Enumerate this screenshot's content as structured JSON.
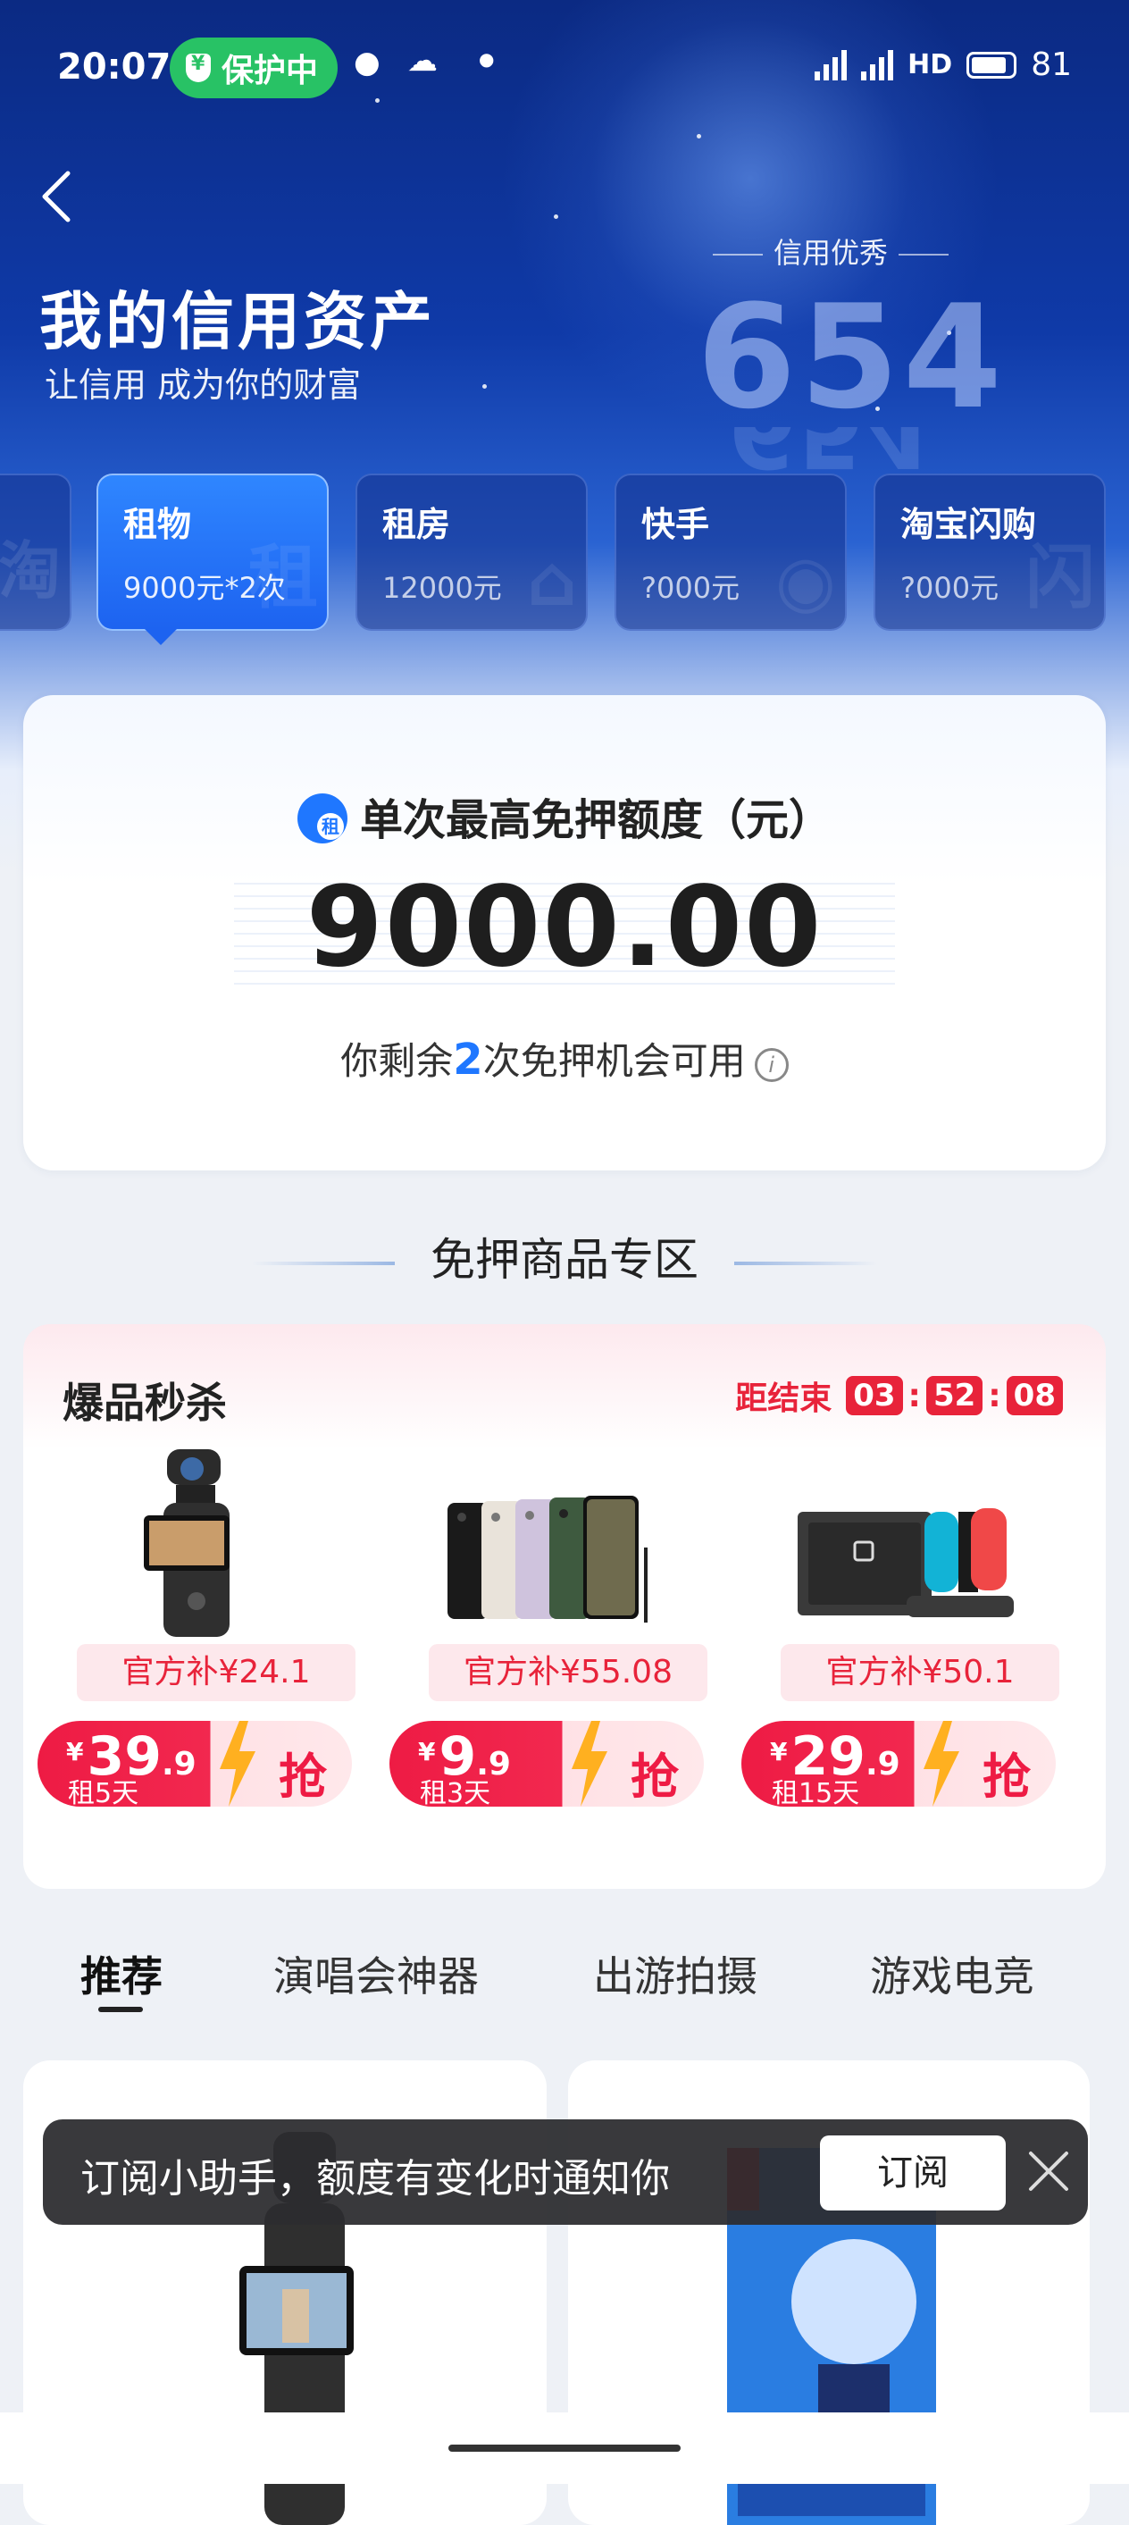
{
  "status_bar": {
    "time": "20:07",
    "protect_label": "保护中",
    "network": "5G 5G HD",
    "battery": "81"
  },
  "header": {
    "title": "我的信用资产",
    "subtitle": "让信用 成为你的财富",
    "credit_label": "信用优秀",
    "credit_score": "654"
  },
  "tabs": [
    {
      "title": "淘",
      "value": ""
    },
    {
      "title": "租物",
      "value": "9000元*2次",
      "watermark": "租"
    },
    {
      "title": "租房",
      "value": "12000元",
      "watermark": "⌂"
    },
    {
      "title": "快手",
      "value": "?000元",
      "watermark": "◉"
    },
    {
      "title": "淘宝闪购",
      "value": "?000元",
      "watermark": "闪"
    }
  ],
  "quota": {
    "title": "单次最高免押额度（元）",
    "amount": "9000.00",
    "remain_prefix": "你剩余",
    "remain_count": "2",
    "remain_suffix": "次免押机会可用"
  },
  "section": {
    "title": "免押商品专区"
  },
  "flash_sale": {
    "title": "爆品秒杀",
    "countdown_label": "距结束",
    "hours": "03",
    "minutes": "52",
    "seconds": "08",
    "products": [
      {
        "name": "camera",
        "subsidy": "官方补¥24.1",
        "currency": "¥",
        "price_int": "39",
        "price_dec": ".9",
        "days": "租5天",
        "grab": "抢"
      },
      {
        "name": "phones",
        "subsidy": "官方补¥55.08",
        "currency": "¥",
        "price_int": "9",
        "price_dec": ".9",
        "days": "租3天",
        "grab": "抢"
      },
      {
        "name": "switch",
        "subsidy": "官方补¥50.1",
        "currency": "¥",
        "price_int": "29",
        "price_dec": ".9",
        "days": "租15天",
        "grab": "抢"
      }
    ]
  },
  "categories": [
    "推荐",
    "演唱会神器",
    "出游拍摄",
    "游戏电竞"
  ],
  "toast": {
    "text": "订阅小助手，额度有变化时通知你",
    "button": "订阅"
  },
  "colors": {
    "accent": "#1f77ff",
    "sale_red": "#e8233a",
    "header_blue": "#0f3aa8"
  }
}
